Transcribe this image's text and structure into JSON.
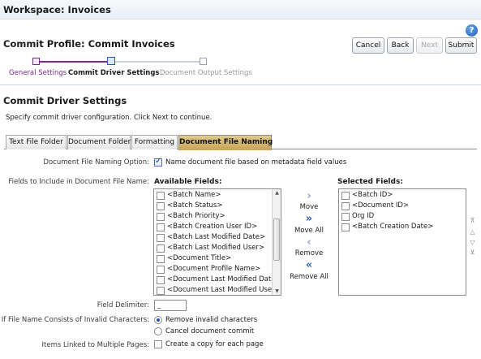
{
  "workspace": {
    "title": "Workspace: Invoices"
  },
  "profile": {
    "title": "Commit Profile: Commit Invoices"
  },
  "buttons": {
    "cancel": "Cancel",
    "back": "Back",
    "next": "Next",
    "submit": "Submit"
  },
  "train": {
    "steps": [
      {
        "label": "General Settings",
        "state": "visited"
      },
      {
        "label": "Commit Driver Settings",
        "state": "current"
      },
      {
        "label": "Document Output Settings",
        "state": "unvisited"
      }
    ]
  },
  "section": {
    "title": "Commit Driver Settings",
    "instructions": "Specify commit driver configuration. Click Next to continue."
  },
  "tabs": [
    "Text File Folder",
    "Document Folder",
    "Formatting",
    "Document File Naming"
  ],
  "active_tab": "Document File Naming",
  "form": {
    "naming_option_label": "Document File Naming Option:",
    "naming_option_text": "Name document file based on metadata field values",
    "naming_option_checked": true,
    "fields_label": "Fields to Include in Document File Name:",
    "available_header": "Available Fields:",
    "selected_header": "Selected Fields:",
    "available_fields": [
      "<Batch Name>",
      "<Batch Status>",
      "<Batch Priority>",
      "<Batch Creation User ID>",
      "<Batch Last Modified Date>",
      "<Batch Last Modified User>",
      "<Document Title>",
      "<Document Profile Name>",
      "<Document Last Modified Date>",
      "<Document Last Modified User"
    ],
    "selected_fields": [
      "<Batch ID>",
      "<Document ID>",
      "Org ID",
      "<Batch Creation Date>"
    ],
    "shuttle": {
      "move": "Move",
      "move_all": "Move All",
      "remove": "Remove",
      "remove_all": "Remove All"
    },
    "delimiter_label": "Field Delimiter:",
    "delimiter_value": "_",
    "invalid_label": "If File Name Consists of Invalid Characters:",
    "invalid_options": [
      {
        "label": "Remove invalid characters",
        "selected": true
      },
      {
        "label": "Cancel document commit",
        "selected": false
      }
    ],
    "linked_label": "Items Linked to Multiple Pages:",
    "linked_text": "Create a copy for each page",
    "linked_checked": false
  },
  "colors": {
    "accent": "#7a2a8c",
    "active_tab": "#c9a456",
    "train_blue": "#4a6fb0"
  }
}
